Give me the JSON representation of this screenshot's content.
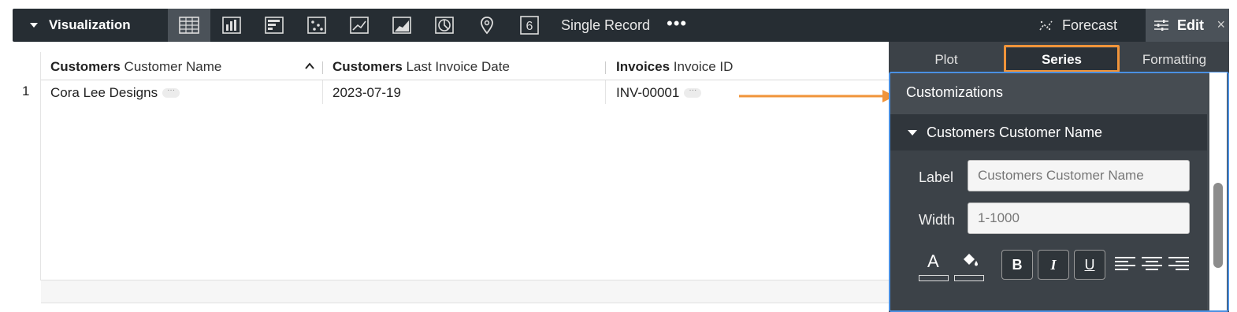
{
  "toolbar": {
    "title": "Visualization",
    "viz_types": [
      {
        "name": "table-icon",
        "active": true
      },
      {
        "name": "column-chart-icon",
        "active": false
      },
      {
        "name": "bar-chart-icon",
        "active": false
      },
      {
        "name": "scatter-icon",
        "active": false
      },
      {
        "name": "line-chart-icon",
        "active": false
      },
      {
        "name": "area-chart-icon",
        "active": false
      },
      {
        "name": "pie-chart-icon",
        "active": false
      },
      {
        "name": "map-pin-icon",
        "active": false
      },
      {
        "name": "single-value-icon",
        "active": false
      }
    ],
    "single_value_glyph": "6",
    "single_record": "Single Record",
    "more": "•••",
    "forecast": "Forecast",
    "edit": "Edit",
    "close": "×"
  },
  "table": {
    "columns": [
      {
        "view": "Customers",
        "field": "Customer Name"
      },
      {
        "view": "Customers",
        "field": "Last Invoice Date"
      },
      {
        "view": "Invoices",
        "field": "Invoice ID"
      }
    ],
    "rows": [
      {
        "num": "1",
        "cells": [
          "Cora Lee Designs",
          "2023-07-19",
          "INV-00001"
        ]
      }
    ],
    "ellipsis": "···"
  },
  "panel": {
    "tabs": [
      {
        "label": "Plot",
        "active": false
      },
      {
        "label": "Series",
        "active": true
      },
      {
        "label": "Formatting",
        "active": false
      }
    ],
    "section_title": "Customizations",
    "series_name": "Customers Customer Name",
    "label_field": {
      "label": "Label",
      "placeholder": "Customers Customer Name"
    },
    "width_field": {
      "label": "Width",
      "placeholder": "1-1000"
    },
    "text_color_glyph": "A",
    "bold": "B",
    "italic": "I",
    "underline": "U"
  },
  "colors": {
    "toolbar_bg": "#262d33",
    "panel_bg": "#3c4248",
    "highlight": "#f0943a",
    "focus_border": "#4a90e2"
  }
}
